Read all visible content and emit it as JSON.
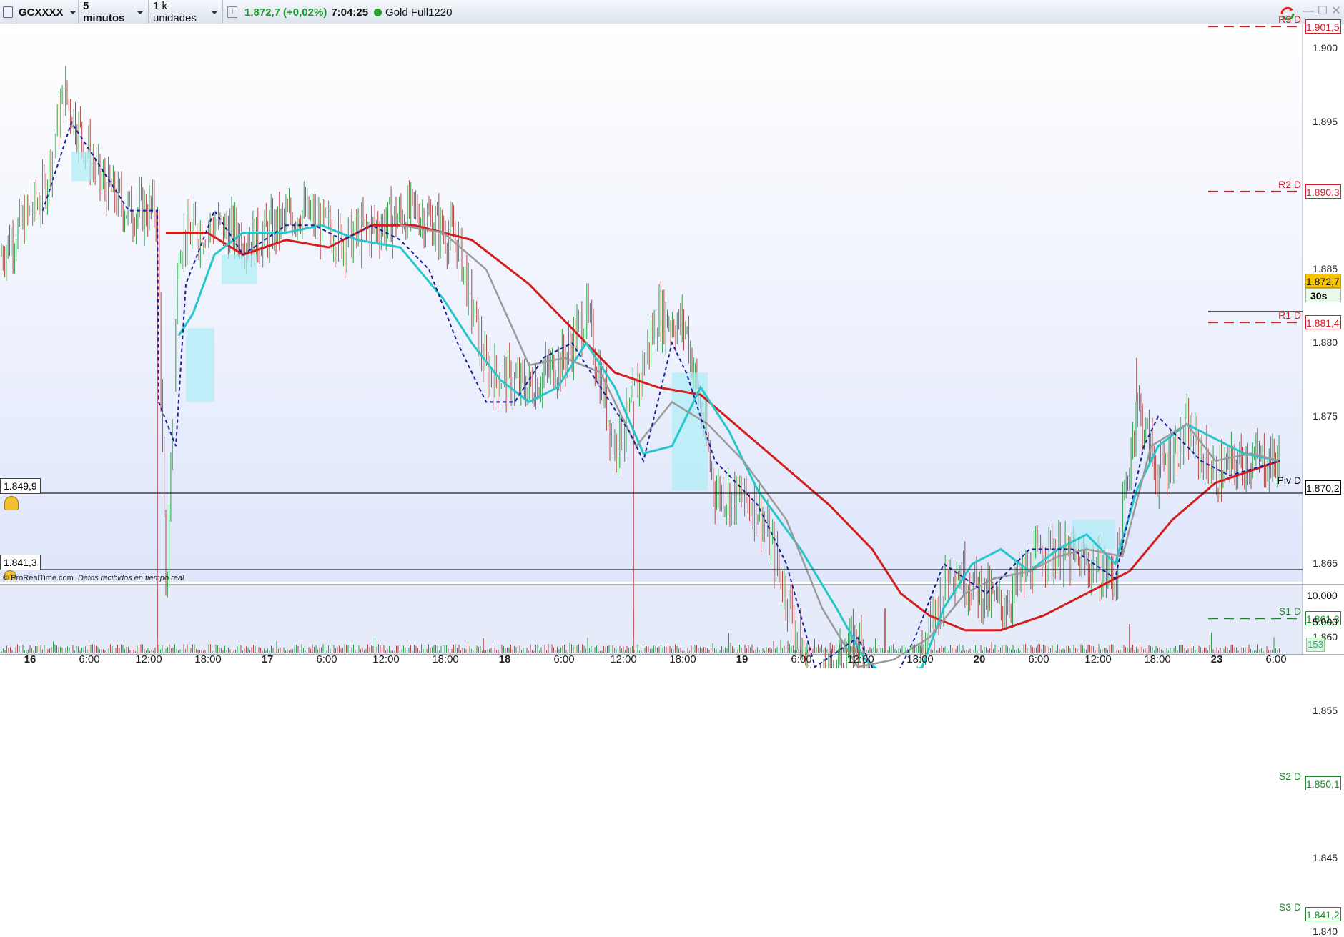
{
  "toolbar": {
    "symbol": "GCXXXX",
    "timeframe": "5 minutos",
    "units": "1 k unidades",
    "price": "1.872,7",
    "change": "(+0,02%)",
    "time": "7:04:25",
    "instrument": "Gold Full1220"
  },
  "pivots": [
    {
      "name": "R3 D",
      "value": "1.901,5",
      "color": "#d21e2b"
    },
    {
      "name": "R2 D",
      "value": "1.890,3",
      "color": "#d21e2b"
    },
    {
      "name": "R1 D",
      "value": "1.881,4",
      "color": "#d21e2b"
    },
    {
      "name": "Piv D",
      "value": "1.870,2",
      "color": "#000000"
    },
    {
      "name": "S1 D",
      "value": "1.861,3",
      "color": "#1e8a2e"
    },
    {
      "name": "S2 D",
      "value": "1.850,1",
      "color": "#1e8a2e"
    },
    {
      "name": "S3 D",
      "value": "1.841,2",
      "color": "#1e8a2e"
    }
  ],
  "price_axis_ticks": [
    "1.900",
    "1.895",
    "1.890",
    "1.885",
    "1.880",
    "1.875",
    "1.870",
    "1.865",
    "1.860",
    "1.855",
    "1.850",
    "1.845",
    "1.840"
  ],
  "current_price_tag": "1.872,7",
  "countdown_tag": "30s",
  "alert_levels": [
    "1.849,9",
    "1.841,3"
  ],
  "footer_text": {
    "brand": "© ProRealTime.com",
    "note": "Datos recibidos en tiempo real"
  },
  "volume_axis": [
    "10.000",
    "5.000"
  ],
  "volume_value": "153",
  "time_axis": [
    {
      "label": "16",
      "bold": true
    },
    {
      "label": "6:00",
      "bold": false
    },
    {
      "label": "12:00",
      "bold": false
    },
    {
      "label": "18:00",
      "bold": false
    },
    {
      "label": "17",
      "bold": true
    },
    {
      "label": "6:00",
      "bold": false
    },
    {
      "label": "12:00",
      "bold": false
    },
    {
      "label": "18:00",
      "bold": false
    },
    {
      "label": "18",
      "bold": true
    },
    {
      "label": "6:00",
      "bold": false
    },
    {
      "label": "12:00",
      "bold": false
    },
    {
      "label": "18:00",
      "bold": false
    },
    {
      "label": "19",
      "bold": true
    },
    {
      "label": "6:00",
      "bold": false
    },
    {
      "label": "12:00",
      "bold": false
    },
    {
      "label": "18:00",
      "bold": false
    },
    {
      "label": "20",
      "bold": true
    },
    {
      "label": "6:00",
      "bold": false
    },
    {
      "label": "12:00",
      "bold": false
    },
    {
      "label": "18:00",
      "bold": false
    },
    {
      "label": "23",
      "bold": true
    },
    {
      "label": "6:00",
      "bold": false
    }
  ],
  "colors": {
    "background_top": "#ffffff",
    "background_bottom": "#dfe6fb",
    "ma_slow": "#d41d1d",
    "ma_fast": "#27c6c9",
    "ma_mid": "#9a9a9a",
    "dashed": "#1a1f9e",
    "candle_up": "#2ea24a",
    "candle_down": "#b84646",
    "cloud": "#aeeef7"
  }
}
